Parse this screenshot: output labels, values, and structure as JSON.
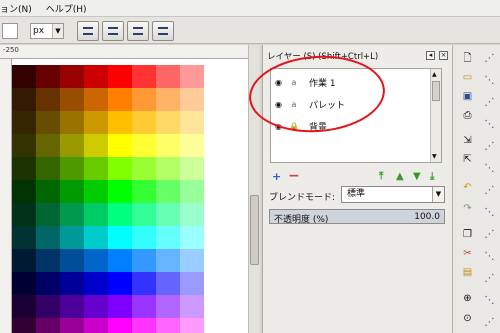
{
  "menu": {
    "partial_left": "ョン(N)",
    "help": "ヘルプ(H)"
  },
  "toolbar": {
    "unit": "px",
    "unit_dropdown_icon": "triangle-down-icon",
    "arrange_button_icons": [
      "align-top-icon",
      "align-bottom-icon",
      "raise-icon",
      "lower-icon"
    ]
  },
  "ruler": {
    "top_label": "-250"
  },
  "layers_panel": {
    "title": "レイヤー (S) (Shift+Ctrl+L)",
    "layers": [
      {
        "name": "作業 1",
        "visible": true,
        "locked": false
      },
      {
        "name": "パレット",
        "visible": true,
        "locked": false
      },
      {
        "name": "背景",
        "visible": true,
        "locked": true
      }
    ],
    "blend_label": "ブレンドモード:",
    "blend_value": "標準",
    "opacity_label": "不透明度 (%)",
    "opacity_value": "100.0",
    "accent_highlight_color": "#e3141a",
    "controls": [
      "add-layer-icon",
      "remove-layer-icon",
      "raise-to-top-icon",
      "raise-layer-icon",
      "lower-layer-icon",
      "lower-to-bottom-icon"
    ]
  },
  "palette": {
    "rows": [
      [
        "#330000",
        "#660000",
        "#990000",
        "#cc0000",
        "#ff0000",
        "#ff3333",
        "#ff6666",
        "#ff9999"
      ],
      [
        "#331a00",
        "#663300",
        "#994d00",
        "#cc6600",
        "#ff8000",
        "#ff9933",
        "#ffb366",
        "#ffcc99"
      ],
      [
        "#332600",
        "#664d00",
        "#997300",
        "#cc9900",
        "#ffbf00",
        "#ffcc33",
        "#ffd966",
        "#ffe599"
      ],
      [
        "#333300",
        "#666600",
        "#999900",
        "#cccc00",
        "#ffff00",
        "#ffff33",
        "#ffff66",
        "#ffff99"
      ],
      [
        "#1a3300",
        "#336600",
        "#4d9900",
        "#66cc00",
        "#80ff00",
        "#99ff33",
        "#b3ff66",
        "#ccff99"
      ],
      [
        "#003300",
        "#006600",
        "#009900",
        "#00cc00",
        "#00ff00",
        "#33ff33",
        "#66ff66",
        "#99ff99"
      ],
      [
        "#00331a",
        "#006633",
        "#00994d",
        "#00cc66",
        "#00ff80",
        "#33ff99",
        "#66ffb3",
        "#99ffcc"
      ],
      [
        "#003333",
        "#006666",
        "#009999",
        "#00cccc",
        "#00ffff",
        "#33ffff",
        "#66ffff",
        "#99ffff"
      ],
      [
        "#001a33",
        "#003366",
        "#004d99",
        "#0066cc",
        "#0080ff",
        "#3399ff",
        "#66b3ff",
        "#99ccff"
      ],
      [
        "#000033",
        "#000066",
        "#000099",
        "#0000cc",
        "#0000ff",
        "#3333ff",
        "#6666ff",
        "#9999ff"
      ],
      [
        "#1a0033",
        "#330066",
        "#4d0099",
        "#6600cc",
        "#8000ff",
        "#9933ff",
        "#b366ff",
        "#cc99ff"
      ],
      [
        "#330033",
        "#660066",
        "#990099",
        "#cc00cc",
        "#ff00ff",
        "#ff33ff",
        "#ff66ff",
        "#ff99ff"
      ]
    ]
  },
  "side_tools": {
    "icons": [
      "new-document-icon",
      "open-folder-icon",
      "save-icon",
      "print-icon",
      "import-icon",
      "export-icon",
      "undo-icon",
      "redo-icon",
      "copy-icon",
      "cut-icon",
      "paste-icon",
      "zoom-in-icon",
      "zoom-fit-icon",
      "snap-icon",
      "snap-node-icon",
      "snap-bbox-icon"
    ]
  }
}
